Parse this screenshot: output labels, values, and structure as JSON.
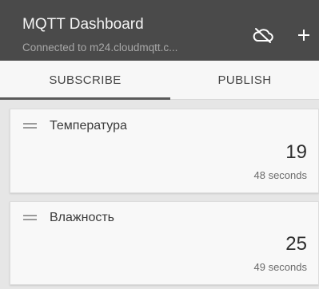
{
  "app": {
    "title": "MQTT Dashboard",
    "subtitle": "Connected to m24.cloudmqtt.c..."
  },
  "toolbar": {
    "cloud_icon": "cloud-off-icon",
    "add_icon": "plus-icon"
  },
  "tabs": [
    {
      "label": "SUBSCRIBE",
      "active": true
    },
    {
      "label": "PUBLISH",
      "active": false
    }
  ],
  "cards": [
    {
      "name": "Температура",
      "value": "19",
      "time": "48 seconds",
      "icon": "drag-handle-icon"
    },
    {
      "name": "Влажность",
      "value": "25",
      "time": "49 seconds",
      "icon": "drag-handle-icon"
    }
  ],
  "colors": {
    "appbar": "#4a4a4a",
    "background": "#e6e6e6",
    "card": "#f8f8f8"
  }
}
